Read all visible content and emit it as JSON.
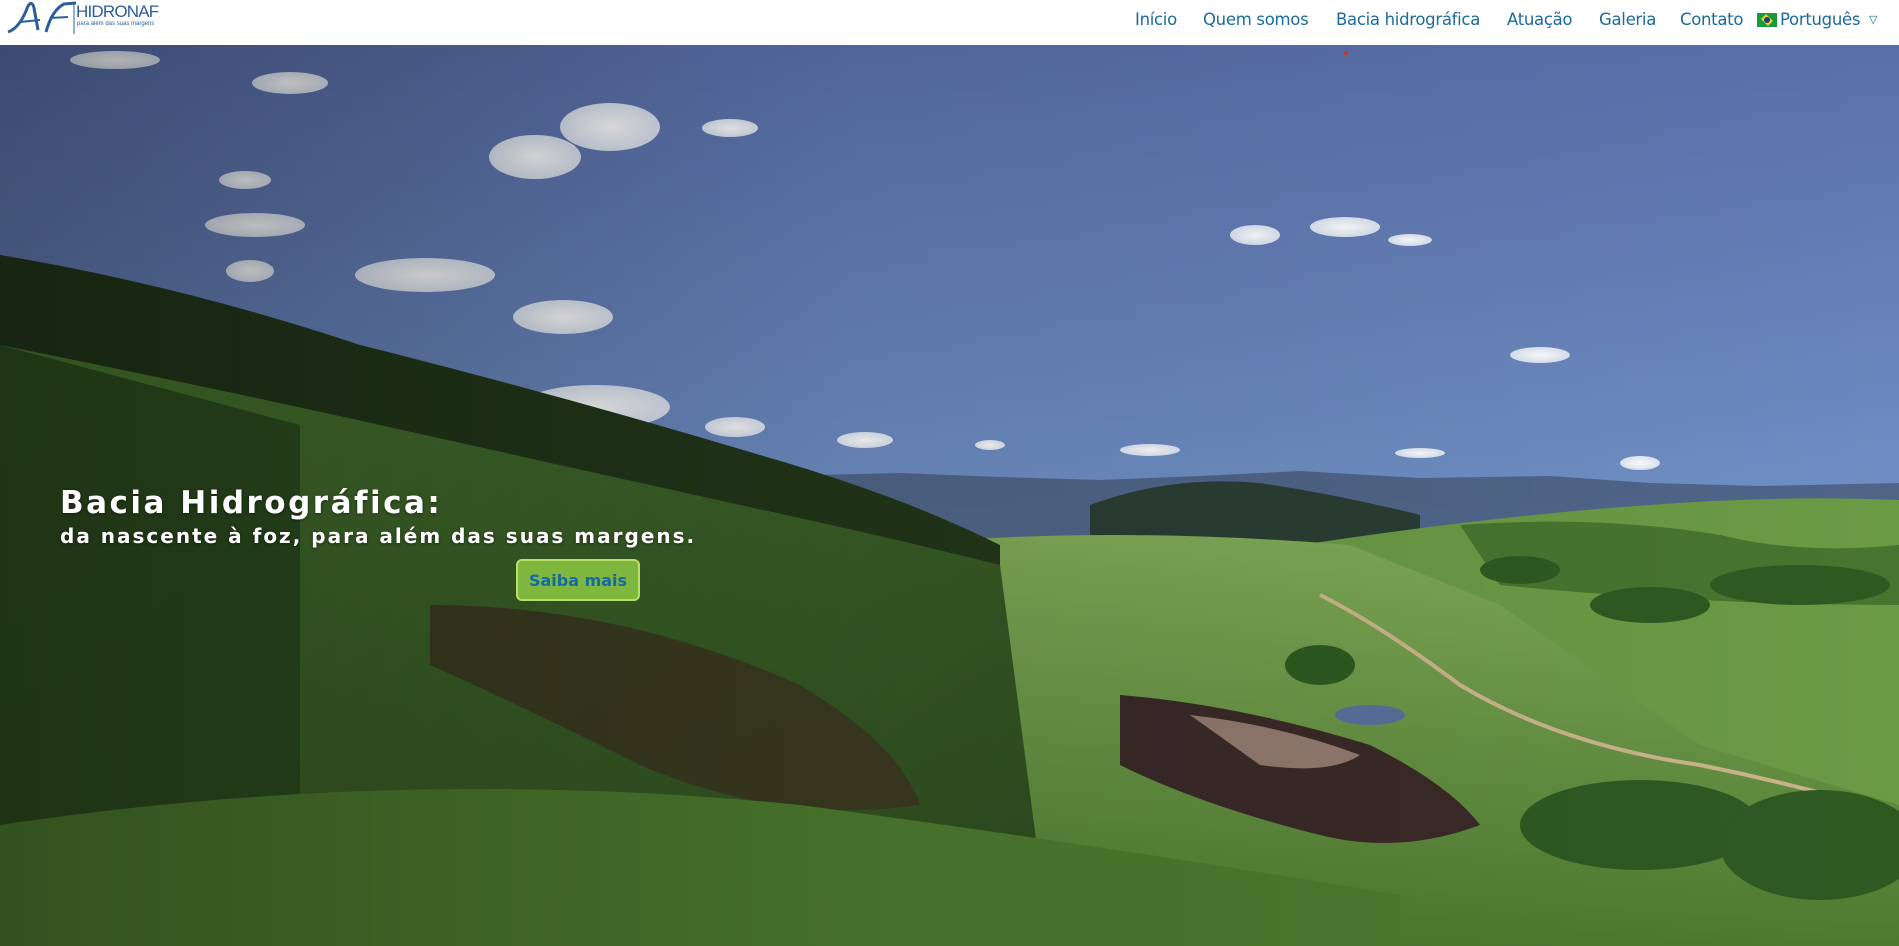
{
  "header": {
    "logo": {
      "mark": "AF",
      "name": "HIDRONAF",
      "tagline": "para além das suas margens"
    },
    "nav": [
      {
        "label": "Início"
      },
      {
        "label": "Quem somos"
      },
      {
        "label": "Bacia hidrográfica"
      },
      {
        "label": "Atuação"
      },
      {
        "label": "Galeria"
      },
      {
        "label": "Contato"
      }
    ],
    "language": {
      "label": "Português",
      "flag_icon": "brazil-flag-icon",
      "dropdown_icon": "chevron-down-icon"
    }
  },
  "hero": {
    "title": "Bacia Hidrográfica:",
    "subtitle": "da nascente à foz, para além das suas margens.",
    "cta_label": "Saiba mais",
    "image": "aerial photo of green valley with hills, blue sky and clouds"
  },
  "colors": {
    "brand_blue": "#1b6aa0",
    "logo_blue": "#2b5f9a",
    "cta_green": "#7fb63e",
    "cta_border": "#b6e06b"
  }
}
